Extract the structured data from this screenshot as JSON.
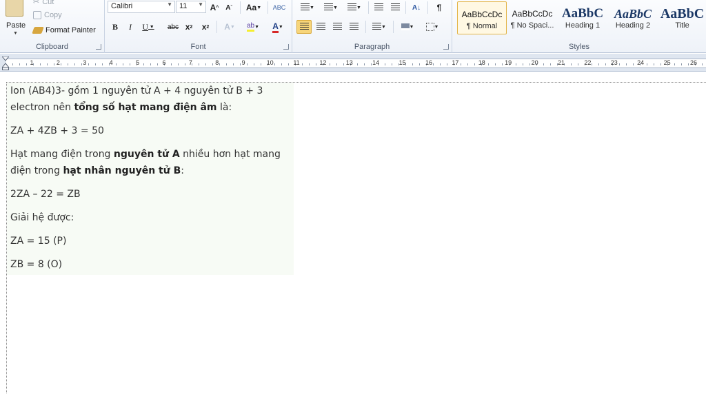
{
  "ribbon": {
    "clipboard": {
      "paste": "Paste",
      "cut": "Cut",
      "copy": "Copy",
      "format_painter": "Format Painter",
      "label": "Clipboard"
    },
    "font": {
      "family": "Calibri",
      "size": "11",
      "change_case": "Aa",
      "label": "Font"
    },
    "paragraph": {
      "label": "Paragraph"
    },
    "styles": {
      "label": "Styles",
      "items": [
        {
          "preview": "AaBbCcDc",
          "name": "¶ Normal"
        },
        {
          "preview": "AaBbCcDc",
          "name": "¶ No Spaci..."
        },
        {
          "preview": "AaBbC",
          "name": "Heading 1"
        },
        {
          "preview": "AaBbC",
          "name": "Heading 2"
        },
        {
          "preview": "AaBbC",
          "name": "Title"
        }
      ]
    }
  },
  "ruler": {
    "numbers": [
      "1",
      "2",
      "3",
      "4",
      "5",
      "6",
      "7",
      "8",
      "9",
      "10",
      "11",
      "12",
      "13",
      "14",
      "15",
      "16",
      "17",
      "18",
      "19",
      "20",
      "21",
      "22",
      "23",
      "24",
      "25",
      "26"
    ]
  },
  "document": {
    "p1_a": "Ion (AB4)3- gồm 1 nguyên tử A + 4 nguyên tử B + 3 electron nên ",
    "p1_b": "tổng số hạt mang điện âm",
    "p1_c": " là:",
    "p2": "ZA + 4ZB + 3 = 50",
    "p3_a": "Hạt mang điện trong ",
    "p3_b": "nguyên tử A",
    "p3_c": " nhiều hơn hạt mang điện trong ",
    "p3_d": "hạt nhân nguyên tử B",
    "p3_e": ":",
    "p4": "2ZA – 22 = ZB",
    "p5": "Giải hệ được:",
    "p6": "ZA = 15 (P)",
    "p7": "ZB = 8 (O)"
  }
}
